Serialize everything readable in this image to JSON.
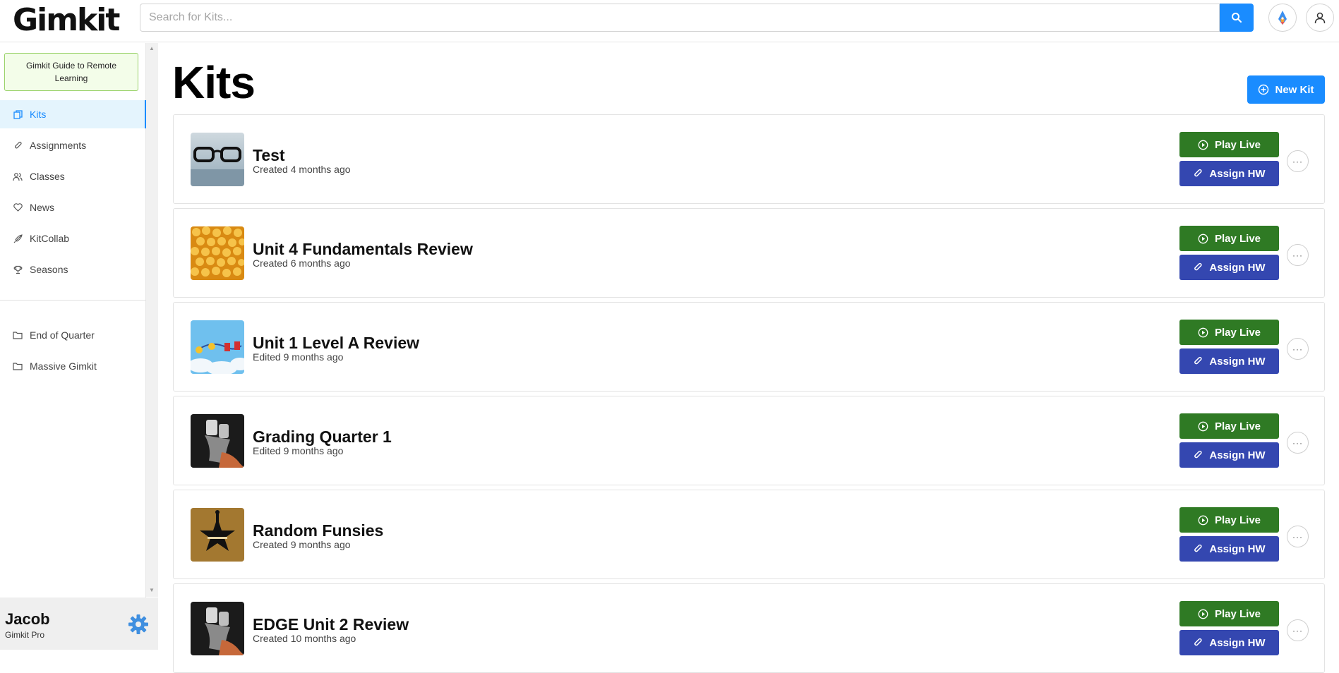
{
  "header": {
    "logo": "Gimkit",
    "search_placeholder": "Search for Kits..."
  },
  "sidebar": {
    "guide_label": "Gimkit Guide to Remote Learning",
    "nav_items": [
      {
        "label": "Kits",
        "icon": "kits-icon",
        "active": true
      },
      {
        "label": "Assignments",
        "icon": "paperclip-icon",
        "active": false
      },
      {
        "label": "Classes",
        "icon": "users-icon",
        "active": false
      },
      {
        "label": "News",
        "icon": "heart-icon",
        "active": false
      },
      {
        "label": "KitCollab",
        "icon": "rocket-icon",
        "active": false
      },
      {
        "label": "Seasons",
        "icon": "trophy-icon",
        "active": false
      }
    ],
    "folders": [
      {
        "label": "End of Quarter",
        "icon": "folder-icon"
      },
      {
        "label": "Massive Gimkit",
        "icon": "folder-icon"
      }
    ],
    "user": {
      "name": "Jacob",
      "plan": "Gimkit Pro"
    }
  },
  "main": {
    "title": "Kits",
    "new_kit_label": "New Kit",
    "play_live_label": "Play Live",
    "assign_hw_label": "Assign HW",
    "more_label": "···",
    "kits": [
      {
        "title": "Test",
        "meta": "Created 4 months ago",
        "thumb": "glasses"
      },
      {
        "title": "Unit 4 Fundamentals Review",
        "meta": "Created 6 months ago",
        "thumb": "popcorn"
      },
      {
        "title": "Unit 1 Level A Review",
        "meta": "Edited 9 months ago",
        "thumb": "sky"
      },
      {
        "title": "Grading Quarter 1",
        "meta": "Edited 9 months ago",
        "thumb": "dark"
      },
      {
        "title": "Random Funsies",
        "meta": "Created 9 months ago",
        "thumb": "hamilton"
      },
      {
        "title": "EDGE Unit 2 Review",
        "meta": "Created 10 months ago",
        "thumb": "dark"
      }
    ]
  },
  "colors": {
    "accent": "#1a8cff",
    "play_live": "#2f7a24",
    "assign_hw": "#3447b0",
    "guide_bg": "#f3fde9",
    "active_nav_bg": "#e4f4fd"
  }
}
